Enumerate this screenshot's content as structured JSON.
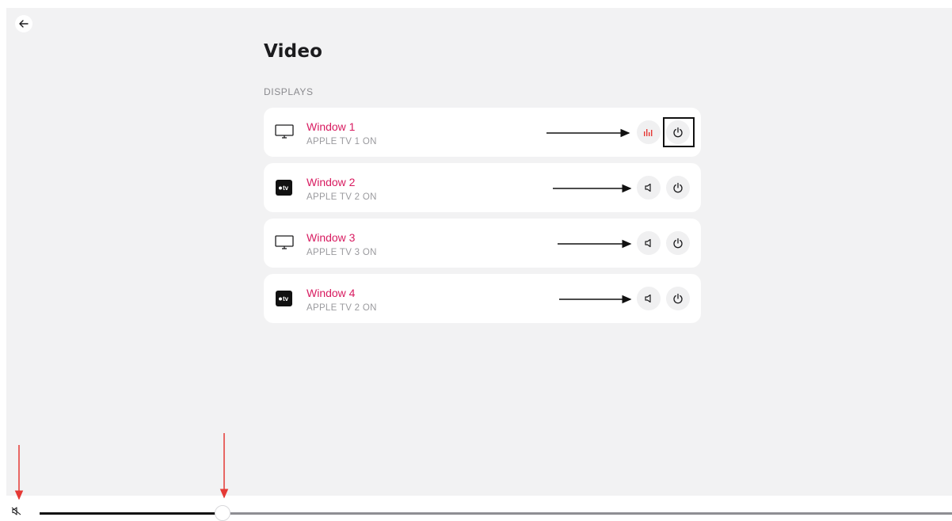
{
  "page": {
    "title": "Video",
    "section_label": "DISPLAYS"
  },
  "icons": {
    "back": "arrow-left-icon",
    "monitor": "monitor-icon",
    "appletv": "apple-tv-icon",
    "volume": "speaker-icon",
    "power": "power-icon",
    "audio_levels": "audio-levels-icon",
    "muted": "muted-speaker-icon"
  },
  "appletv_badge_text": "tv",
  "displays": [
    {
      "name": "Window 1",
      "status": "APPLE TV 1 ON",
      "device": "monitor",
      "audio_active": true
    },
    {
      "name": "Window 2",
      "status": "APPLE TV 2 ON",
      "device": "appletv",
      "audio_active": false
    },
    {
      "name": "Window 3",
      "status": "APPLE TV 3 ON",
      "device": "monitor",
      "audio_active": false
    },
    {
      "name": "Window 4",
      "status": "APPLE TV 2 ON",
      "device": "appletv",
      "audio_active": false
    }
  ],
  "volume_slider": {
    "muted": true,
    "level": 0.23
  },
  "colors": {
    "accent": "#d81b60",
    "background_panel": "#f2f2f3",
    "card": "#ffffff",
    "annotation_red": "#e53935"
  }
}
